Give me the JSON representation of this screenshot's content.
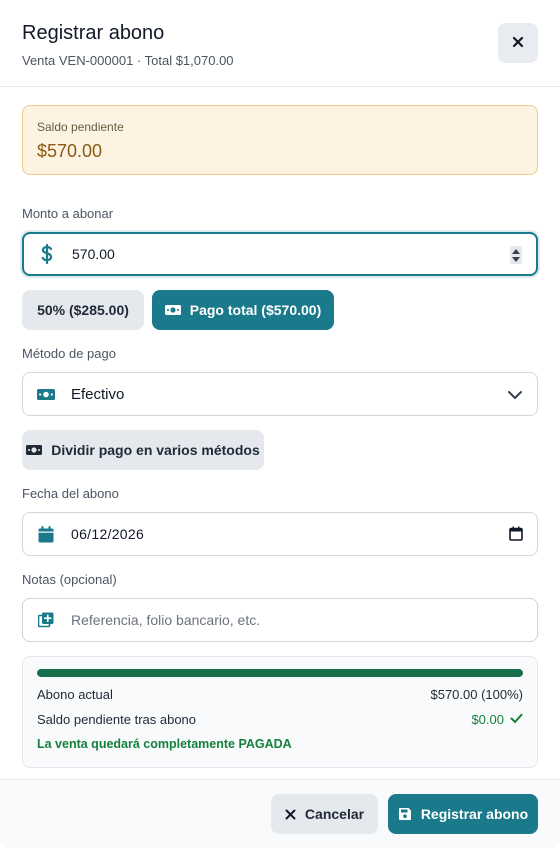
{
  "header": {
    "title": "Registrar abono",
    "subtitle": "Venta VEN-000001 · Total $1,070.00"
  },
  "balance": {
    "label": "Saldo pendiente",
    "value": "$570.00"
  },
  "amount": {
    "label": "Monto a abonar",
    "value": "570.00"
  },
  "quick_buttons": {
    "half": "50% ($285.00)",
    "full": "Pago total ($570.00)"
  },
  "method": {
    "label": "Método de pago",
    "selected": "Efectivo"
  },
  "split_button": "Dividir pago en varios métodos",
  "date": {
    "label": "Fecha del abono",
    "value": "06/12/2026"
  },
  "notes": {
    "label": "Notas (opcional)",
    "placeholder": "Referencia, folio bancario, etc."
  },
  "summary": {
    "progress_fraction": 1.0,
    "current_label": "Abono actual",
    "current_value": "$570.00 (100%)",
    "remaining_label": "Saldo pendiente tras abono",
    "remaining_value": "$0.00",
    "paid_message": "La venta quedará completamente PAGADA"
  },
  "footer": {
    "cancel": "Cancelar",
    "submit": "Registrar abono"
  },
  "colors": {
    "primary": "#1a7a8c",
    "success": "#15803d",
    "warning_bg": "#fdf3e2"
  }
}
